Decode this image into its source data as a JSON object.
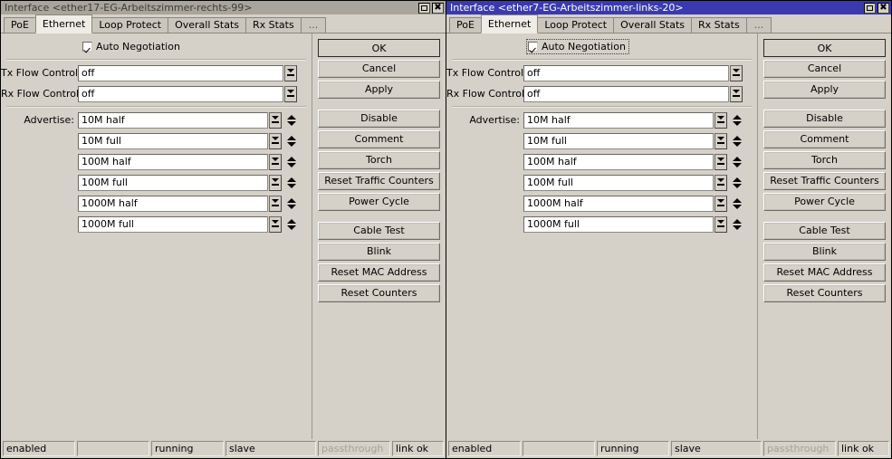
{
  "windows": [
    {
      "id": "left",
      "active": false,
      "title": "Interface <ether17-EG-Arbeitszimmer-rechts-99>",
      "controls": {
        "maximize": "maximize-icon",
        "close": "close-icon"
      },
      "tabs": [
        {
          "label": "PoE",
          "active": false
        },
        {
          "label": "Ethernet",
          "active": true
        },
        {
          "label": "Loop Protect",
          "active": false
        },
        {
          "label": "Overall Stats",
          "active": false
        },
        {
          "label": "Rx Stats",
          "active": false
        },
        {
          "label": "...",
          "active": false
        }
      ],
      "auto_negotiation": {
        "label": "Auto Negotiation",
        "checked": true,
        "focused": false
      },
      "fields": [
        {
          "label": "Tx Flow Control",
          "value": "off",
          "spinner": false
        },
        {
          "label": "Rx Flow Control",
          "value": "off",
          "spinner": false
        }
      ],
      "advertise": {
        "label": "Advertise:",
        "rows": [
          {
            "value": "10M half"
          },
          {
            "value": "10M full"
          },
          {
            "value": "100M half"
          },
          {
            "value": "100M full"
          },
          {
            "value": "1000M half"
          },
          {
            "value": "1000M full"
          }
        ]
      },
      "buttons": [
        {
          "label": "OK",
          "default": true
        },
        {
          "label": "Cancel",
          "default": false
        },
        {
          "label": "Apply",
          "default": false
        },
        {
          "gap": true
        },
        {
          "label": "Disable",
          "default": false
        },
        {
          "label": "Comment",
          "default": false
        },
        {
          "label": "Torch",
          "default": false
        },
        {
          "label": "Reset Traffic Counters",
          "default": false
        },
        {
          "label": "Power Cycle",
          "default": false
        },
        {
          "gap": true
        },
        {
          "label": "Cable Test",
          "default": false
        },
        {
          "label": "Blink",
          "default": false
        },
        {
          "label": "Reset MAC Address",
          "default": false
        },
        {
          "label": "Reset Counters",
          "default": false
        }
      ],
      "status": [
        {
          "text": "enabled",
          "dim": false
        },
        {
          "text": "",
          "dim": false
        },
        {
          "text": "running",
          "dim": false
        },
        {
          "text": "slave",
          "dim": false
        },
        {
          "text": "passthrough",
          "dim": true
        },
        {
          "text": "link ok",
          "dim": false
        }
      ]
    },
    {
      "id": "right",
      "active": true,
      "title": "Interface <ether7-EG-Arbeitszimmer-links-20>",
      "controls": {
        "maximize": "maximize-icon",
        "close": "close-icon"
      },
      "tabs": [
        {
          "label": "PoE",
          "active": false
        },
        {
          "label": "Ethernet",
          "active": true
        },
        {
          "label": "Loop Protect",
          "active": false
        },
        {
          "label": "Overall Stats",
          "active": false
        },
        {
          "label": "Rx Stats",
          "active": false
        },
        {
          "label": "...",
          "active": false
        }
      ],
      "auto_negotiation": {
        "label": "Auto Negotiation",
        "checked": true,
        "focused": true
      },
      "fields": [
        {
          "label": "Tx Flow Control",
          "value": "off",
          "spinner": false
        },
        {
          "label": "Rx Flow Control",
          "value": "off",
          "spinner": false
        }
      ],
      "advertise": {
        "label": "Advertise:",
        "rows": [
          {
            "value": "10M half"
          },
          {
            "value": "10M full"
          },
          {
            "value": "100M half"
          },
          {
            "value": "100M full"
          },
          {
            "value": "1000M half"
          },
          {
            "value": "1000M full"
          }
        ]
      },
      "buttons": [
        {
          "label": "OK",
          "default": true
        },
        {
          "label": "Cancel",
          "default": false
        },
        {
          "label": "Apply",
          "default": false
        },
        {
          "gap": true
        },
        {
          "label": "Disable",
          "default": false
        },
        {
          "label": "Comment",
          "default": false
        },
        {
          "label": "Torch",
          "default": false
        },
        {
          "label": "Reset Traffic Counters",
          "default": false
        },
        {
          "label": "Power Cycle",
          "default": false
        },
        {
          "gap": true
        },
        {
          "label": "Cable Test",
          "default": false
        },
        {
          "label": "Blink",
          "default": false
        },
        {
          "label": "Reset MAC Address",
          "default": false
        },
        {
          "label": "Reset Counters",
          "default": false
        }
      ],
      "status": [
        {
          "text": "enabled",
          "dim": false
        },
        {
          "text": "",
          "dim": false
        },
        {
          "text": "running",
          "dim": false
        },
        {
          "text": "slave",
          "dim": false
        },
        {
          "text": "passthrough",
          "dim": true
        },
        {
          "text": "link ok",
          "dim": false
        }
      ]
    }
  ],
  "colors": {
    "title_active": "#3a3ab0",
    "title_inactive": "#a9a59c",
    "face": "#d5d1c8",
    "field_bg": "#ffffff",
    "dim_text": "#a6a29a"
  }
}
